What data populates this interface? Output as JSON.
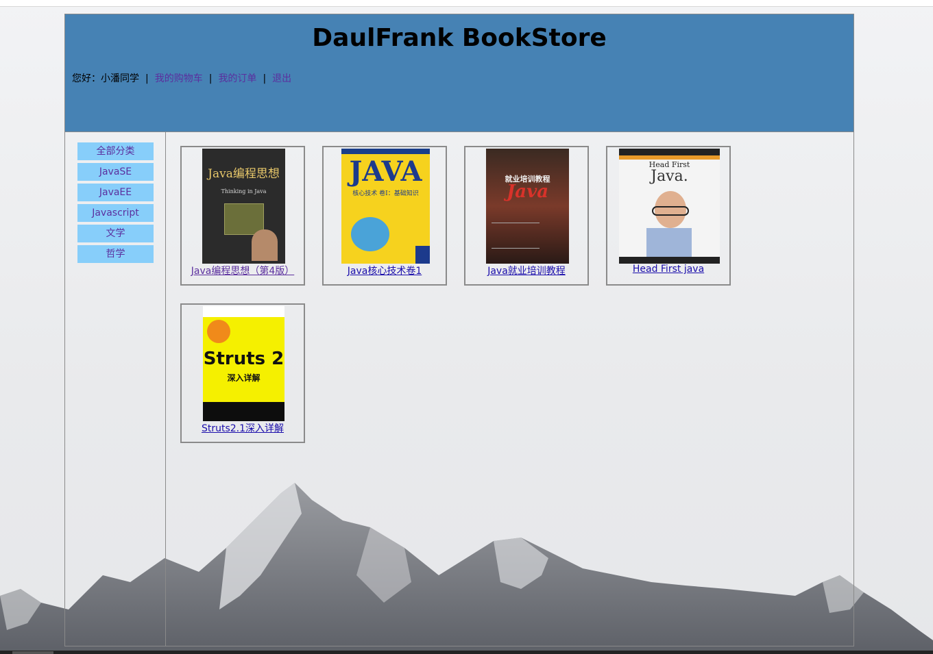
{
  "header": {
    "title": "DaulFrank BookStore"
  },
  "user_nav": {
    "greeting": "您好：小潘同学",
    "cart": "我的购物车",
    "orders": "我的订单",
    "logout": "退出",
    "separator": "|"
  },
  "categories": [
    {
      "label": "全部分类"
    },
    {
      "label": "JavaSE"
    },
    {
      "label": "JavaEE"
    },
    {
      "label": "Javascript"
    },
    {
      "label": "文学"
    },
    {
      "label": "哲学"
    }
  ],
  "books": [
    {
      "title": "Java编程思想（第4版）",
      "cover_text": "Java编程思想",
      "cover_sub": "Thinking in Java",
      "cover_color": "#2b2b2b"
    },
    {
      "title": "Java核心技术卷1",
      "cover_text": "JAVA",
      "cover_sub": "核心技术 卷I：基础知识",
      "cover_color": "#f6d21e"
    },
    {
      "title": "Java就业培训教程",
      "cover_text": "Java",
      "cover_sub": "就业培训教程",
      "cover_color": "#4a2a1e"
    },
    {
      "title": "Head First java",
      "cover_text": "Java.",
      "cover_sub": "Head First",
      "cover_color": "#f4f4f4"
    },
    {
      "title": "Struts2.1深入详解",
      "cover_text": "Struts 2",
      "cover_sub": "深入详解",
      "cover_color": "#f5f000"
    }
  ],
  "colors": {
    "header_bg": "#4682b4",
    "category_bg": "#87cefa",
    "link": "#1a0dab",
    "visited_link": "#5b2f9e"
  }
}
